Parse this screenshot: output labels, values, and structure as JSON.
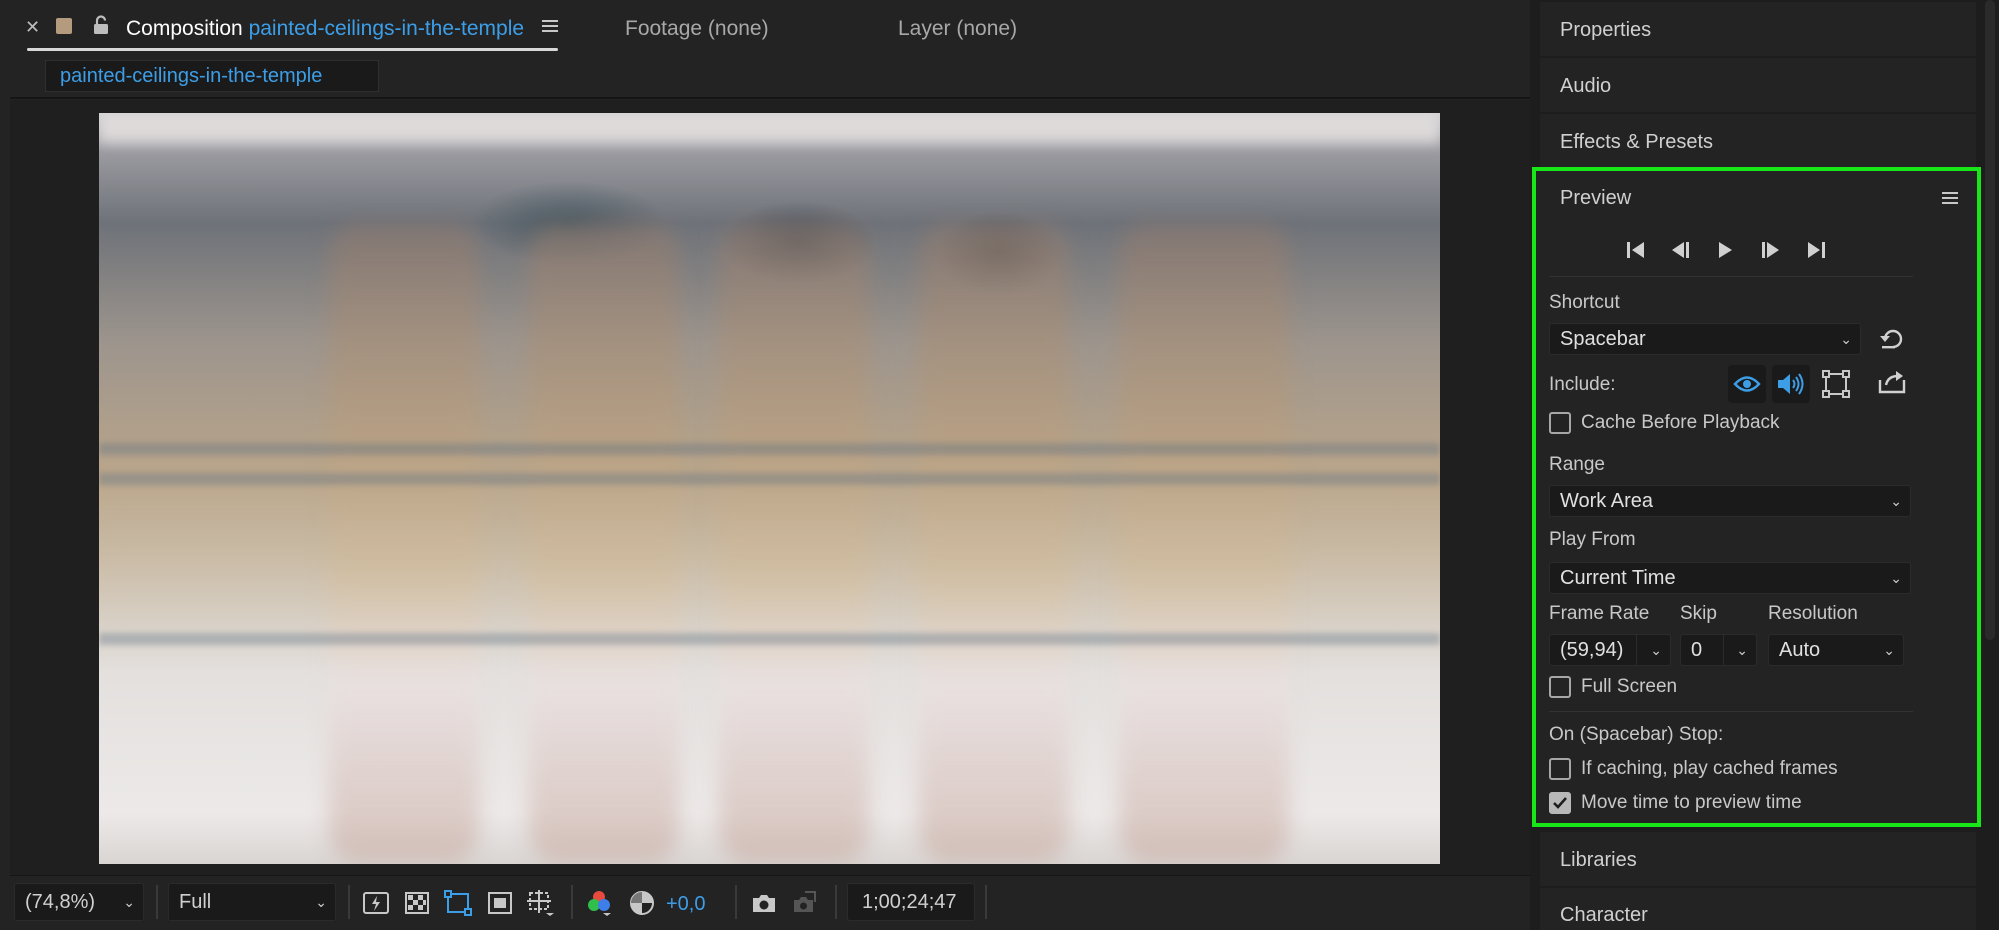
{
  "colors": {
    "accent": "#3d9ee8",
    "highlight_border": "#19e619",
    "panel_bg": "#232323"
  },
  "tabs": {
    "composition": {
      "label": "Composition",
      "name": "painted-ceilings-in-the-temple"
    },
    "footage": "Footage (none)",
    "layer": "Layer (none)"
  },
  "breadcrumb": "painted-ceilings-in-the-temple",
  "toolbar": {
    "zoom": "(74,8%)",
    "resolution": "Full",
    "exposure": "+0,0",
    "timecode": "1;00;24;47"
  },
  "panels": {
    "properties": "Properties",
    "audio": "Audio",
    "effects": "Effects & Presets",
    "libraries": "Libraries",
    "character": "Character"
  },
  "preview": {
    "title": "Preview",
    "shortcut_label": "Shortcut",
    "shortcut_value": "Spacebar",
    "include_label": "Include:",
    "cache_before_playback": "Cache Before Playback",
    "range_label": "Range",
    "range_value": "Work Area",
    "play_from_label": "Play From",
    "play_from_value": "Current Time",
    "frame_rate_label": "Frame Rate",
    "skip_label": "Skip",
    "resolution_label": "Resolution",
    "frame_rate_value": "(59,94)",
    "skip_value": "0",
    "resolution_value": "Auto",
    "full_screen": "Full Screen",
    "on_stop_label": "On (Spacebar) Stop:",
    "if_caching": "If caching, play cached frames",
    "move_time": "Move time to preview time",
    "cache_checked": false,
    "full_screen_checked": false,
    "if_caching_checked": false,
    "move_time_checked": true
  }
}
